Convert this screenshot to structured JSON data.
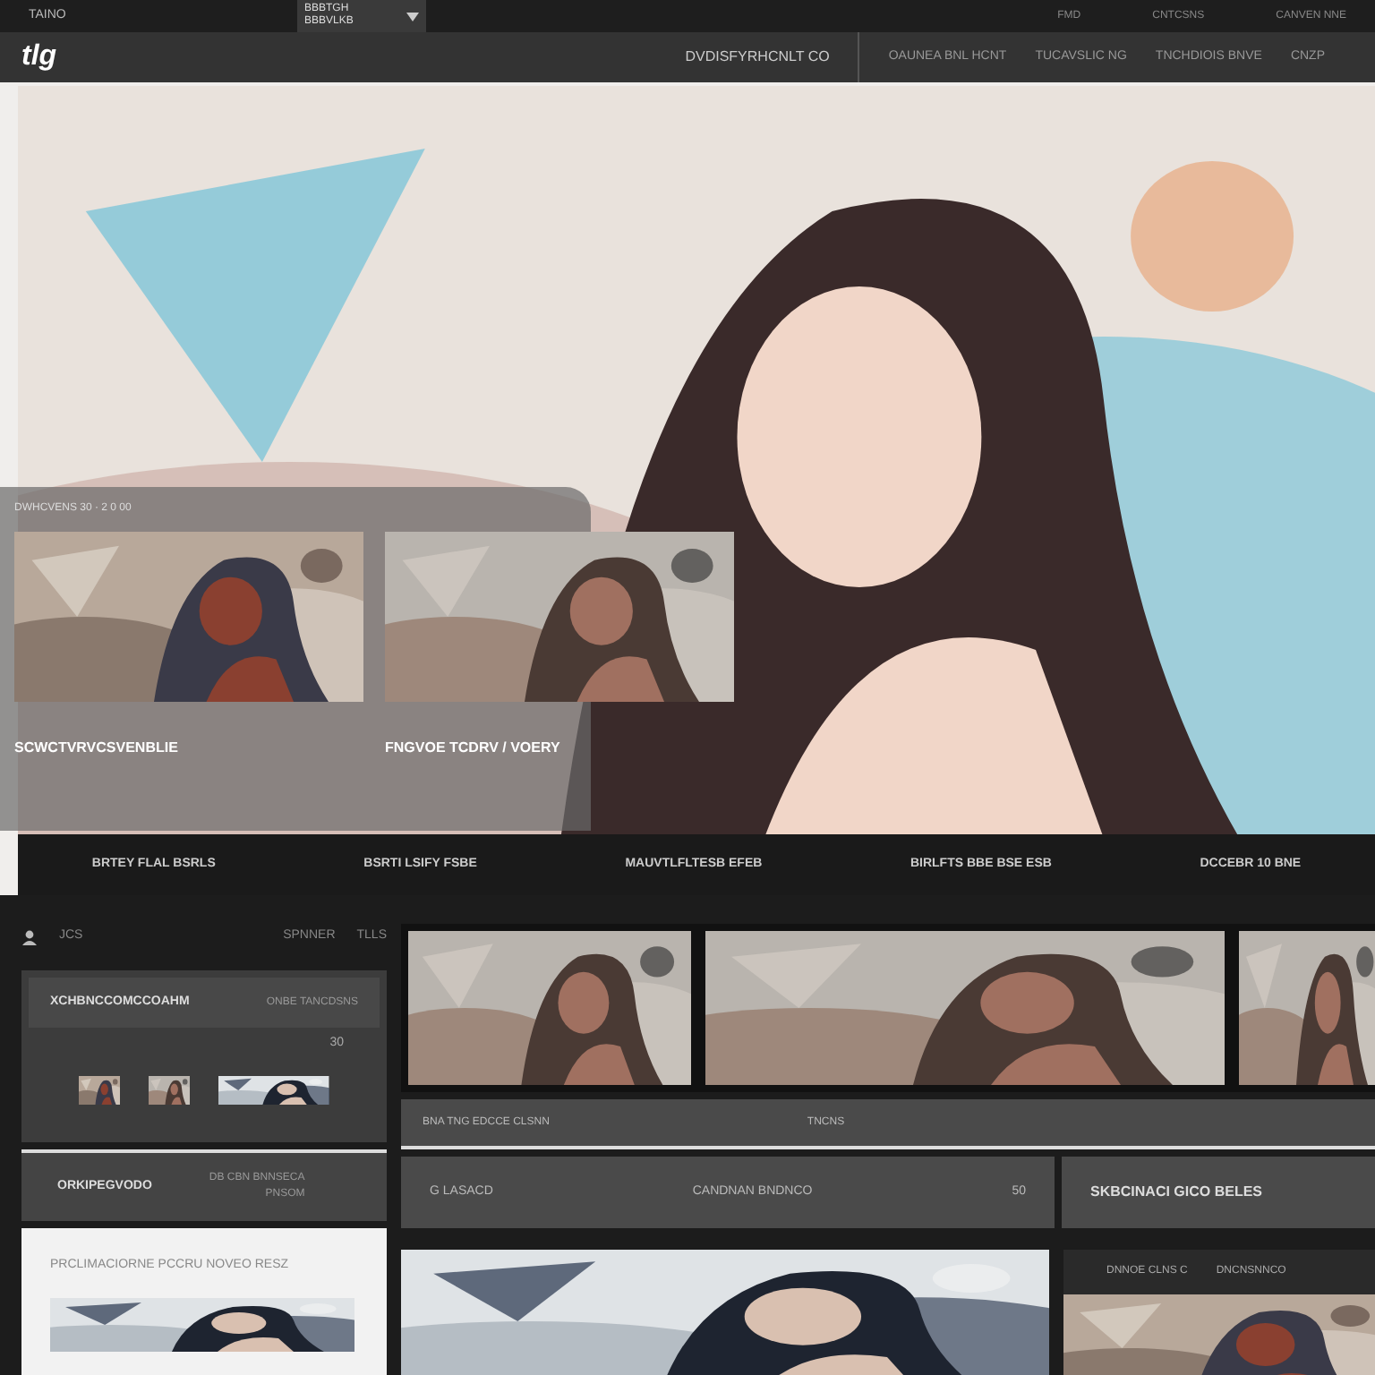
{
  "top_bar": {
    "brand": "TAINO",
    "dropdown": [
      "BBBTGH",
      "BBBVLKB"
    ],
    "links": [
      "FMD",
      "CNTCSNS",
      "CANVEN NNE"
    ]
  },
  "nav": {
    "logo": "tlg",
    "title": "DVDISFYRHCNLT CO",
    "links": [
      "OAUNEA BNL HCNT",
      "TUCAVSLIC NG",
      "TNCHDIOIS BNVE",
      "CNZP"
    ]
  },
  "hero": {
    "caption": "DWHCVENS 30 · 2 0 00",
    "cards": [
      {
        "title": "SCWCTVRVCSVENBLIE"
      },
      {
        "title": "FNGVOE TCDRV / VOERY"
      }
    ],
    "strip": [
      "BRTEY FLAL BSRLS",
      "BSRTI LSIFY FSBE",
      "MAUVTLFLTESB EFEB",
      "BIRLFTS BBE BSE ESB",
      "DCCEBR 10 BNE"
    ]
  },
  "sidebar": {
    "label": "JCS",
    "tabs": [
      "SPNNER",
      "TLLS"
    ],
    "card": {
      "title": "XCHBNCCOMCCOAHM",
      "meta": "ONBE TANCDSNS",
      "count": "30"
    },
    "row": {
      "title": "ORKIPEGVODO",
      "meta": "DB CBN BNNSECA",
      "sub": "PNSOM"
    },
    "feature": {
      "title": "PRCLIMACIORNE PCCRU NOVEO RESZ"
    }
  },
  "gallery": {
    "bar": [
      "BNA TNG EDCCE CLSNN",
      "TNCNS"
    ],
    "row": {
      "label": "G LASACD",
      "title": "CANDNAN BNDNCO",
      "count": "50"
    },
    "side_title": "SKBCINACI GICO BELES",
    "panel": [
      "DNNOE CLNS C",
      "DNCNSNNCO"
    ]
  }
}
